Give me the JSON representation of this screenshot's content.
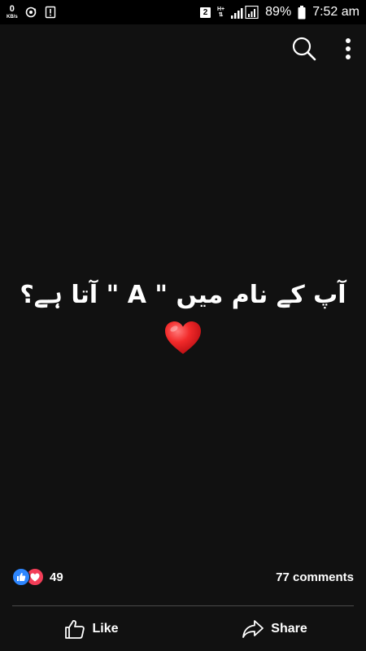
{
  "status_bar": {
    "data_speed_value": "0",
    "data_speed_unit": "KB/s",
    "sim_slot": "2",
    "network_type": "H+",
    "battery_percent": "89%",
    "time": "7:52 am",
    "icons": [
      "data-speed",
      "sync-icon",
      "alert-icon",
      "sim-icon",
      "signal-icon",
      "battery-icon"
    ]
  },
  "toolbar": {
    "icons": [
      "search-icon",
      "more-vertical-icon"
    ]
  },
  "post": {
    "text": "آپ کے نام میں \" A \" آتا ہے؟",
    "emoji": "red-heart"
  },
  "engagement": {
    "reaction_count": "49",
    "comments": "77 comments",
    "reactions": [
      "like",
      "love"
    ]
  },
  "actions": {
    "like_label": "Like",
    "share_label": "Share"
  },
  "colors": {
    "background": "#111111",
    "status_bar": "#000000",
    "like_blue": "#2d86ff",
    "love_red": "#f33e58",
    "text": "#ffffff"
  }
}
